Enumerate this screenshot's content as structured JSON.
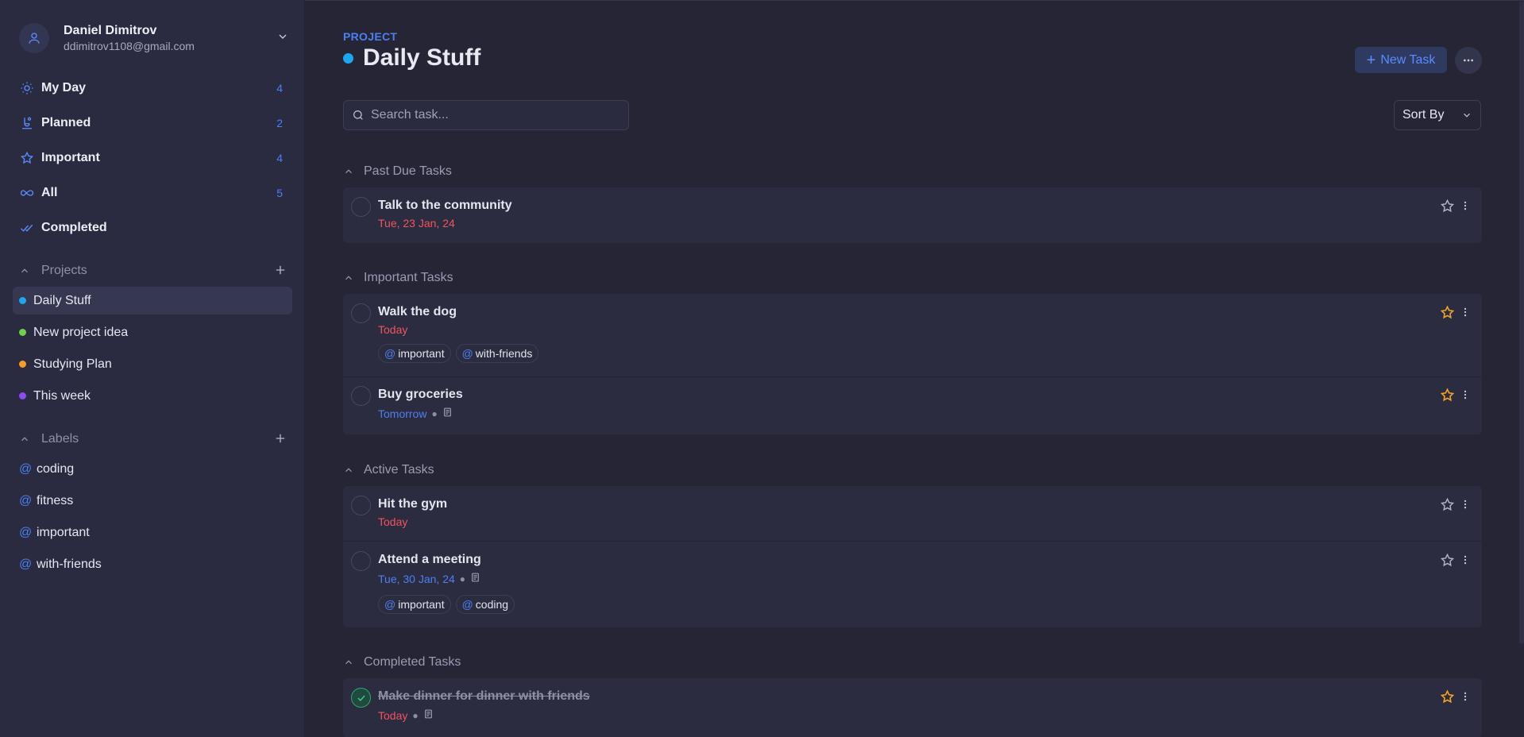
{
  "user": {
    "name": "Daniel Dimitrov",
    "email": "ddimitrov1108@gmail.com"
  },
  "nav": [
    {
      "label": "My Day",
      "count": "4",
      "icon": "sun-icon"
    },
    {
      "label": "Planned",
      "count": "2",
      "icon": "calendar-icon"
    },
    {
      "label": "Important",
      "count": "4",
      "icon": "star-icon"
    },
    {
      "label": "All",
      "count": "5",
      "icon": "infinity-icon"
    },
    {
      "label": "Completed",
      "count": "",
      "icon": "double-check-icon"
    }
  ],
  "projects_section": {
    "title": "Projects"
  },
  "projects": [
    {
      "label": "Daily Stuff",
      "color": "#1ea7f0",
      "active": true
    },
    {
      "label": "New project idea",
      "color": "#6fd14a",
      "active": false
    },
    {
      "label": "Studying Plan",
      "color": "#f59a2c",
      "active": false
    },
    {
      "label": "This week",
      "color": "#8b4cf0",
      "active": false
    }
  ],
  "labels_section": {
    "title": "Labels"
  },
  "labels": [
    {
      "at": "@",
      "label": "coding"
    },
    {
      "at": "@",
      "label": "fitness"
    },
    {
      "at": "@",
      "label": "important"
    },
    {
      "at": "@",
      "label": "with-friends"
    }
  ],
  "header": {
    "kicker": "PROJECT",
    "title": "Daily Stuff",
    "new_task_label": "New Task",
    "search_placeholder": "Search task...",
    "sort_label": "Sort By"
  },
  "colors": {
    "accent": "#4d7ff2",
    "danger": "#f0545f",
    "star": "#f5a623",
    "success": "#2fa673"
  },
  "groups": [
    {
      "title": "Past Due Tasks",
      "tasks": [
        {
          "title": "Talk to the community",
          "date": "Tue, 23 Jan, 24",
          "date_color": "red",
          "starred": false,
          "has_note": false,
          "tags": [],
          "completed": false
        }
      ]
    },
    {
      "title": "Important Tasks",
      "tasks": [
        {
          "title": "Walk the dog",
          "date": "Today",
          "date_color": "red",
          "starred": true,
          "has_note": false,
          "tags": [
            "important",
            "with-friends"
          ],
          "completed": false
        },
        {
          "title": "Buy groceries",
          "date": "Tomorrow",
          "date_color": "blue",
          "starred": true,
          "has_note": true,
          "tags": [],
          "completed": false
        }
      ]
    },
    {
      "title": "Active Tasks",
      "tasks": [
        {
          "title": "Hit the gym",
          "date": "Today",
          "date_color": "red",
          "starred": false,
          "has_note": false,
          "tags": [],
          "completed": false
        },
        {
          "title": "Attend a meeting",
          "date": "Tue, 30 Jan, 24",
          "date_color": "blue",
          "starred": false,
          "has_note": true,
          "tags": [
            "important",
            "coding"
          ],
          "completed": false
        }
      ]
    },
    {
      "title": "Completed Tasks",
      "tasks": [
        {
          "title": "Make dinner for dinner with friends",
          "date": "Today",
          "date_color": "red",
          "starred": true,
          "has_note": true,
          "tags": [],
          "completed": true
        }
      ]
    }
  ]
}
